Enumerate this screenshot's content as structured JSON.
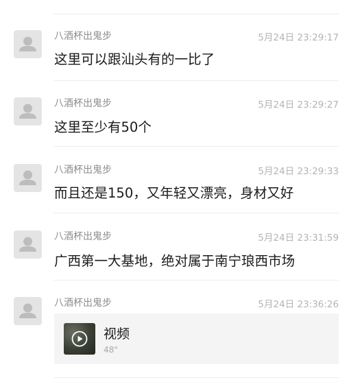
{
  "messages": [
    {
      "sender": "八酒杯出鬼步",
      "time": "5月24日 23:29:17",
      "text": "这里可以跟汕头有的一比了"
    },
    {
      "sender": "八酒杯出鬼步",
      "time": "5月24日 23:29:27",
      "text": "这里至少有50个"
    },
    {
      "sender": "八酒杯出鬼步",
      "time": "5月24日 23:29:33",
      "text": "而且还是150，又年轻又漂亮，身材又好"
    },
    {
      "sender": "八酒杯出鬼步",
      "time": "5月24日 23:31:59",
      "text": "广西第一大基地，绝对属于南宁琅西市场"
    },
    {
      "sender": "八酒杯出鬼步",
      "time": "5月24日 23:36:26",
      "video": {
        "title": "视频",
        "duration": "48\""
      }
    }
  ],
  "icons": {
    "avatar": "default-user-icon",
    "play": "play-circle-icon"
  }
}
